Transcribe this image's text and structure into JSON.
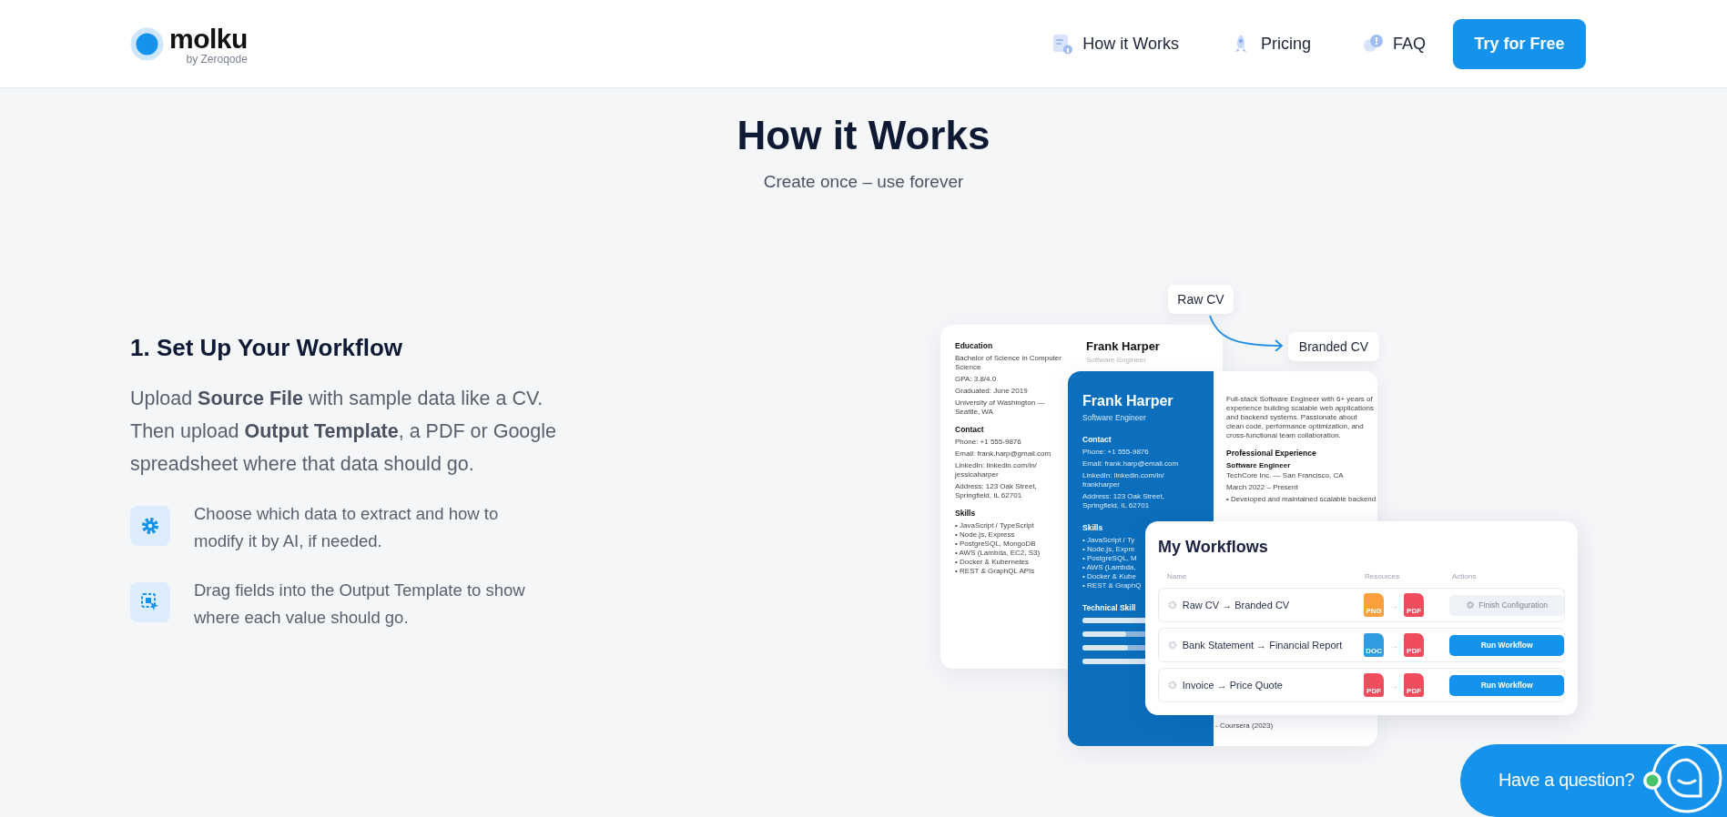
{
  "header": {
    "logo": {
      "name": "molku",
      "byline": "by Zeroqode"
    },
    "nav": [
      {
        "label": "How it Works"
      },
      {
        "label": "Pricing"
      },
      {
        "label": "FAQ"
      }
    ],
    "cta": "Try for Free"
  },
  "hero": {
    "title": "How it Works",
    "subtitle": "Create once – use forever"
  },
  "step": {
    "title": "1. Set Up Your Workflow",
    "text": "Upload **Source File** with sample data like a CV. Then upload **Output Template**, a PDF or Google spreadsheet where that data should go.",
    "items": [
      {
        "text": "Choose which data to extract and how to modify it by AI, if needed."
      },
      {
        "text": "Drag fields into the Output Template to show where each value should go."
      }
    ]
  },
  "illustration": {
    "tags": [
      "Raw CV",
      "Branded CV"
    ],
    "raw_cv": {
      "name": "Frank Harper",
      "role": "Software Engineer",
      "sections": [
        {
          "heading": "Education",
          "lines": [
            "Bachelor of Science in Computer Science",
            "GPA: 3.8/4.0",
            "Graduated: June 2019",
            "University of Washington — Seattle, WA"
          ]
        },
        {
          "heading": "Contact",
          "lines": [
            "Phone: +1 555-9876",
            "Email: frank.harp@gmail.com",
            "LinkedIn: linkedin.com/in/ jessicaharper",
            "Address: 123 Oak Street, Springfield, IL 62701"
          ]
        },
        {
          "heading": "Skills",
          "bullets": [
            "• JavaScript / TypeScript",
            "• Node.js, Express",
            "• PostgreSQL, MongoDB",
            "• AWS (Lambda, EC2, S3)",
            "• Docker & Kubernetes",
            "• REST & GraphQL APIs"
          ]
        }
      ]
    },
    "branded_cv": {
      "name": "Frank Harper",
      "role": "Software Engineer",
      "contact_heading": "Contact",
      "contact": [
        "Phone: +1 555-9876",
        "Email: frank.harp@email.com",
        "LinkedIn: linkedin.com/in/ frankharper",
        "Address: 123 Oak Street, Springfield, IL 62701"
      ],
      "skills_heading": "Skills",
      "skills": [
        "• JavaScript / Ty",
        "• Node.js, Expre",
        "• PostgreSQL, M",
        "• AWS (Lambda,",
        "• Docker & Kube",
        "• REST & GraphQ"
      ],
      "tech_heading": "Technical Skill",
      "skill_bars": [
        {
          "level": 0.6
        },
        {
          "level": 0.4
        },
        {
          "level": 0.42
        },
        {
          "level": 1
        }
      ],
      "summary": "Full-stack Software Engineer with 6+ years of experience building scalable web applications and backend systems. Passionate about clean code, performance optimization, and cross-functional team collaboration.",
      "experience_heading": "Professional Experience",
      "job_title": "Software Engineer",
      "company": "TechCore Inc. — San Francisco, CA",
      "dates": "March 2022 – Present",
      "bullet": "• Developed and maintained scalable backend",
      "course": "- Coursera (2023)"
    },
    "workflows": {
      "title": "My Workflows",
      "columns": [
        "Name",
        "Resources",
        "Actions"
      ],
      "rows": [
        {
          "name": "Raw CV → Branded CV",
          "from": {
            "label": "PNG",
            "color": "#f9a03c"
          },
          "separator": "→",
          "to": {
            "label": "PDF",
            "color": "#ef4c5e"
          },
          "action": {
            "label": "Finish Configuration",
            "kind": "secondary"
          }
        },
        {
          "name": "Bank Statement → Financial Report",
          "from": {
            "label": "DOC",
            "color": "#2f9be0"
          },
          "separator": "→",
          "to": {
            "label": "PDF",
            "color": "#ef4c5e"
          },
          "action": {
            "label": "Run Workflow",
            "kind": "primary"
          }
        },
        {
          "name": "Invoice → Price Quote",
          "from": {
            "label": "PDF",
            "color": "#ef4c5e"
          },
          "separator": "→",
          "to": {
            "label": "PDF",
            "color": "#ef4c5e"
          },
          "action": {
            "label": "Run Workflow",
            "kind": "primary"
          }
        }
      ]
    }
  },
  "chat": {
    "label": "Have a question?",
    "online": true
  }
}
